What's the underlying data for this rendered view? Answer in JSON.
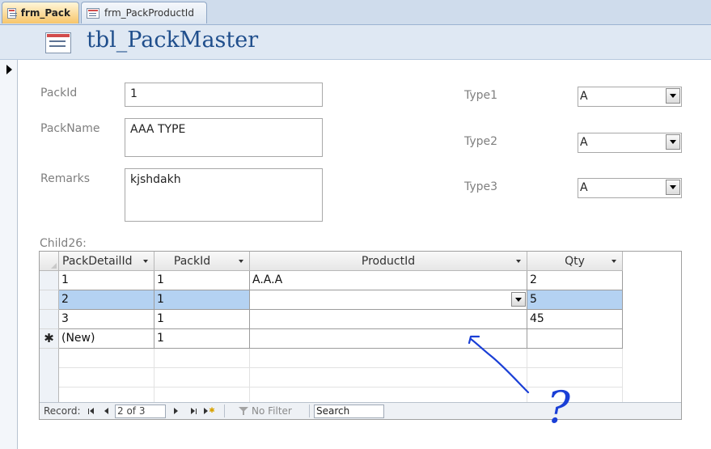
{
  "tabs": [
    {
      "label": "frm_Pack",
      "active": true
    },
    {
      "label": "frm_PackProductId",
      "active": false
    }
  ],
  "header": {
    "title": "tbl_PackMaster"
  },
  "fields": {
    "packid": {
      "label": "PackId",
      "value": "1"
    },
    "packname": {
      "label": "PackName",
      "value": "AAA TYPE"
    },
    "remarks": {
      "label": "Remarks",
      "value": "kjshdakh"
    },
    "type1": {
      "label": "Type1",
      "value": "A"
    },
    "type2": {
      "label": "Type2",
      "value": "A"
    },
    "type3": {
      "label": "Type3",
      "value": "A"
    }
  },
  "subform": {
    "label": "Child26:",
    "columns": [
      "PackDetailId",
      "PackId",
      "ProductId",
      "Qty"
    ],
    "rows": [
      {
        "selector": "",
        "cells": [
          "1",
          "1",
          "A.A.A",
          "2"
        ]
      },
      {
        "selector": "",
        "cells": [
          "2",
          "1",
          "",
          "5"
        ]
      },
      {
        "selector": "",
        "cells": [
          "3",
          "1",
          "",
          "45"
        ]
      },
      {
        "selector": "✱",
        "cells": [
          "(New)",
          "1",
          "",
          ""
        ]
      }
    ],
    "navigation": {
      "label": "Record:",
      "current": "2 of 3",
      "filter": "No Filter",
      "search": "Search"
    }
  },
  "colors": {
    "accent": "#1f4e8c",
    "selection": "#b4d2f2",
    "annotation": "#1a3fd6"
  },
  "annotation": {
    "glyph": "?"
  }
}
